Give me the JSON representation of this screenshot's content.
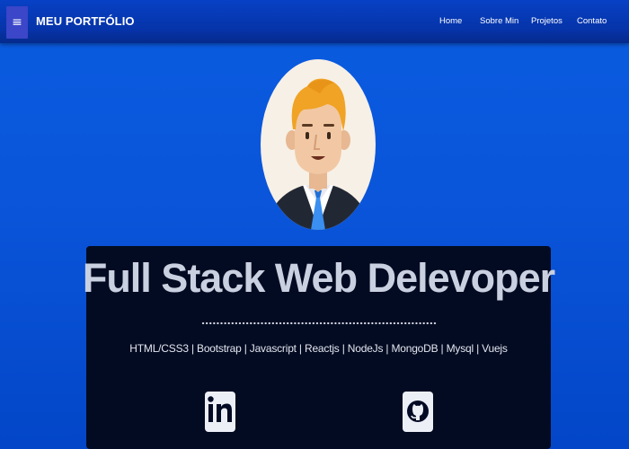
{
  "navbar": {
    "menu_icon": "≡",
    "brand": "MEU PORTFÓLIO",
    "links": [
      "Home",
      "Sobre Min",
      "Projetos",
      "Contato"
    ]
  },
  "hero": {
    "avatar_icon": "developer-avatar-icon",
    "headline": "Full Stack Web Delevoper",
    "skills": "HTML/CSS3 | Bootstrap | Javascript | Reactjs | NodeJs | MongoDB | Mysql | Vuejs"
  },
  "social": {
    "linkedin_icon": "linkedin-icon",
    "github_icon": "github-icon"
  },
  "colors": {
    "background": "#0a55da",
    "navbar": "#0633a8",
    "card": "#030b22",
    "menu_button": "#3b46c8"
  }
}
